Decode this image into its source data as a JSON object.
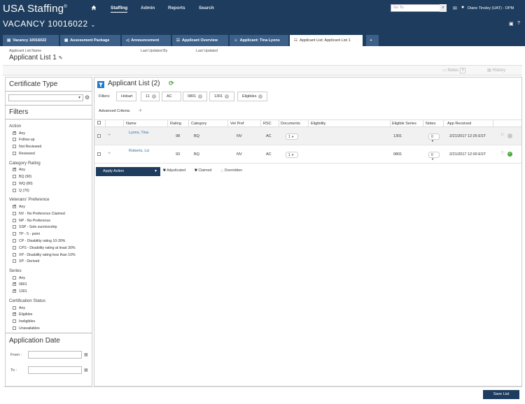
{
  "app": {
    "logo": "USA Staffing",
    "logo_mark": "®"
  },
  "nav": [
    "Staffing",
    "Admin",
    "Reports",
    "Search"
  ],
  "search": {
    "placeholder": "Go To"
  },
  "user": {
    "name": "Diane Tinsley (UAT) - OPM"
  },
  "vacancy": {
    "title": "VACANCY 10016022"
  },
  "tabs": [
    "Vacancy 10016022",
    "Assessment Package",
    "Announcement",
    "Applicant Overview",
    "Applicant: Tina Lyons",
    "Applicant List: Applicant List 1",
    "+"
  ],
  "header": {
    "name_label": "Applicant List Name",
    "name_value": "Applicant List 1",
    "updated_by_label": "Last Updated By",
    "updated_label": "Last Updated"
  },
  "subbar": {
    "notes_label": "Notes",
    "notes_count": "0",
    "history_label": "History"
  },
  "left": {
    "cert_type_title": "Certificate Type",
    "filters_title": "Filters",
    "groups": [
      {
        "label": "Action",
        "items": [
          {
            "label": "Any",
            "checked": true
          },
          {
            "label": "Follow-up",
            "checked": false
          },
          {
            "label": "Not Reviewed",
            "checked": false
          },
          {
            "label": "Reviewed",
            "checked": false
          }
        ]
      },
      {
        "label": "Category Rating",
        "items": [
          {
            "label": "Any",
            "checked": true
          },
          {
            "label": "BQ (90)",
            "checked": false
          },
          {
            "label": "WQ (80)",
            "checked": false
          },
          {
            "label": "Q (70)",
            "checked": false
          }
        ]
      },
      {
        "label": "Veterans' Preference",
        "items": [
          {
            "label": "Any",
            "checked": true
          },
          {
            "label": "NV - No Preference Claimed",
            "checked": false
          },
          {
            "label": "NP - No Preference",
            "checked": false
          },
          {
            "label": "SSP - Sole survivorship",
            "checked": false
          },
          {
            "label": "TP - 5 - point",
            "checked": false
          },
          {
            "label": "CP - Disability rating 10-30%",
            "checked": false
          },
          {
            "label": "CPS - Disability rating at least 30%",
            "checked": false
          },
          {
            "label": "XP - Disability rating less than 10%",
            "checked": false
          },
          {
            "label": "XP - Derived",
            "checked": false
          }
        ]
      },
      {
        "label": "Series",
        "items": [
          {
            "label": "Any",
            "checked": false
          },
          {
            "label": "0801",
            "checked": true
          },
          {
            "label": "1301",
            "checked": true
          }
        ]
      },
      {
        "label": "Certification Status",
        "items": [
          {
            "label": "Any",
            "checked": false
          },
          {
            "label": "Eligibles",
            "checked": true
          },
          {
            "label": "Ineligibles",
            "checked": false
          },
          {
            "label": "Unavailables",
            "checked": false
          }
        ]
      }
    ],
    "app_date_title": "Application Date",
    "from_label": "From :",
    "to_label": "To :"
  },
  "list": {
    "title": "Applicant List (2)",
    "filters_label": "Filters:",
    "chips": [
      "Hobart",
      "11",
      "AC",
      "0801",
      "1301",
      "Eligibles"
    ],
    "advanced_label": "Advanced Criteria:",
    "columns": [
      "Name",
      "Rating",
      "Category",
      "Vet Pref",
      "RSC",
      "Documents",
      "Eligibility",
      "Eligible Series",
      "Notes",
      "App Received"
    ],
    "rows": [
      {
        "name": "Lyons, Tina",
        "rating": "98",
        "category": "BQ",
        "vet_pref": "NV",
        "rsc": "AC",
        "documents": "1",
        "eligible_series": "1301",
        "notes": "0",
        "received": "2/21/2017 12:26 EST",
        "status": "pending"
      },
      {
        "name": "Roberts, Liz",
        "rating": "93",
        "category": "BQ",
        "vet_pref": "NV",
        "rsc": "AC",
        "documents": "1",
        "eligible_series": "0801",
        "notes": "0",
        "received": "2/21/2017 12:00 EST",
        "status": "ok"
      }
    ],
    "apply_action": "Apply Action",
    "legend": [
      "Adjudicated",
      "Claimed",
      "Overridden"
    ]
  },
  "footer": {
    "save_label": "Save List"
  },
  "colors": {
    "navy": "#1e3d5e",
    "tab": "#3c6089",
    "accent_blue": "#1f7acb",
    "green": "#4caa3b"
  }
}
